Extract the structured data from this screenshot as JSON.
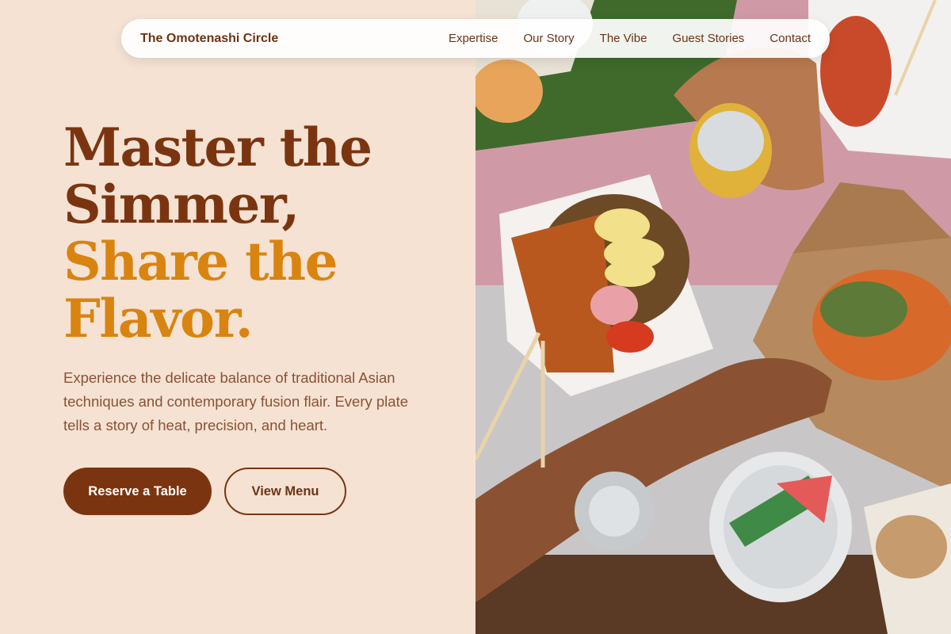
{
  "nav": {
    "brand": "The Omotenashi Circle",
    "links": [
      "Expertise",
      "Our Story",
      "The Vibe",
      "Guest Stories",
      "Contact"
    ]
  },
  "hero": {
    "title_line1": "Master the",
    "title_line2": "Simmer,",
    "title_line3": "Share the",
    "title_line4": "Flavor.",
    "description": "Experience the delicate balance of traditional Asian techniques and contemporary fusion flair. Every plate tells a story of heat, precision, and heart.",
    "primary_button": "Reserve a Table",
    "secondary_button": "View Menu"
  },
  "colors": {
    "background": "#f5e2d3",
    "brand_brown": "#7a3510",
    "accent_amber": "#d98410",
    "body_text": "#8a5236"
  }
}
